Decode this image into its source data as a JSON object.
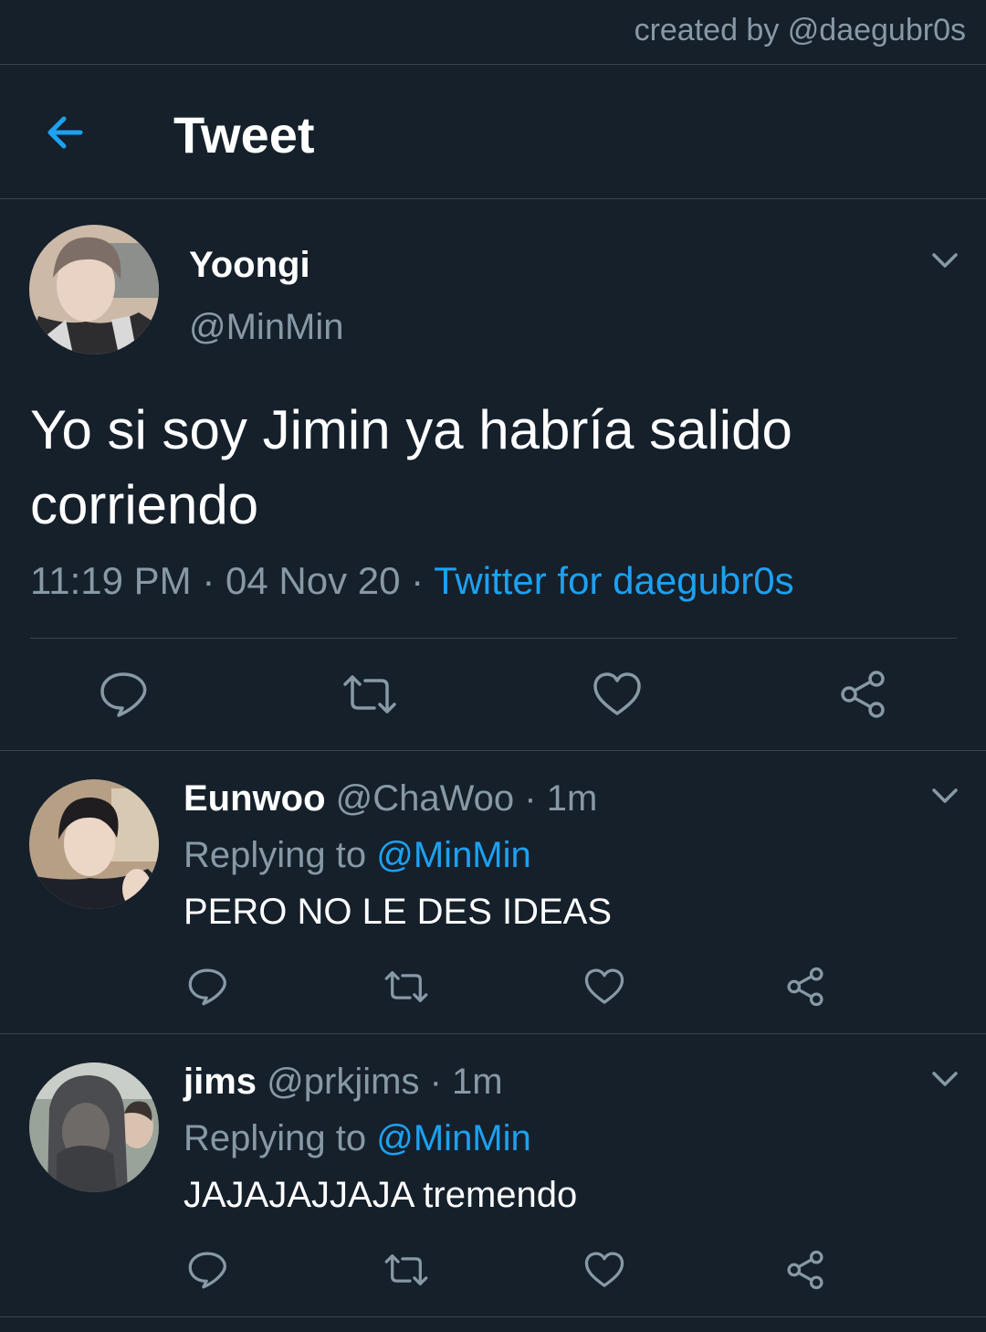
{
  "watermark": "created by @daegubr0s",
  "header": {
    "title": "Tweet",
    "back_icon": "arrow-left-icon"
  },
  "colors": {
    "background": "#15202b",
    "accent": "#1da1f2",
    "secondary_text": "#8899a6",
    "divider": "#38444d"
  },
  "tweet": {
    "name": "Yoongi",
    "handle": "@MinMin",
    "text": "Yo si soy Jimin ya habría salido corriendo",
    "time": "11:19 PM",
    "separator": "·",
    "date": "04 Nov 20",
    "client": "Twitter for daegubr0s",
    "actions": [
      "reply-icon",
      "retweet-icon",
      "like-icon",
      "share-icon"
    ]
  },
  "replies": [
    {
      "name": "Eunwoo",
      "handle": "@ChaWoo",
      "time": "· 1m",
      "replying_prefix": "Replying to",
      "replying_to": "@MinMin",
      "text": "PERO NO LE DES IDEAS"
    },
    {
      "name": "jims",
      "handle": "@prkjims",
      "time": "· 1m",
      "replying_prefix": "Replying to",
      "replying_to": "@MinMin",
      "text": "JAJAJAJJAJA tremendo"
    }
  ]
}
